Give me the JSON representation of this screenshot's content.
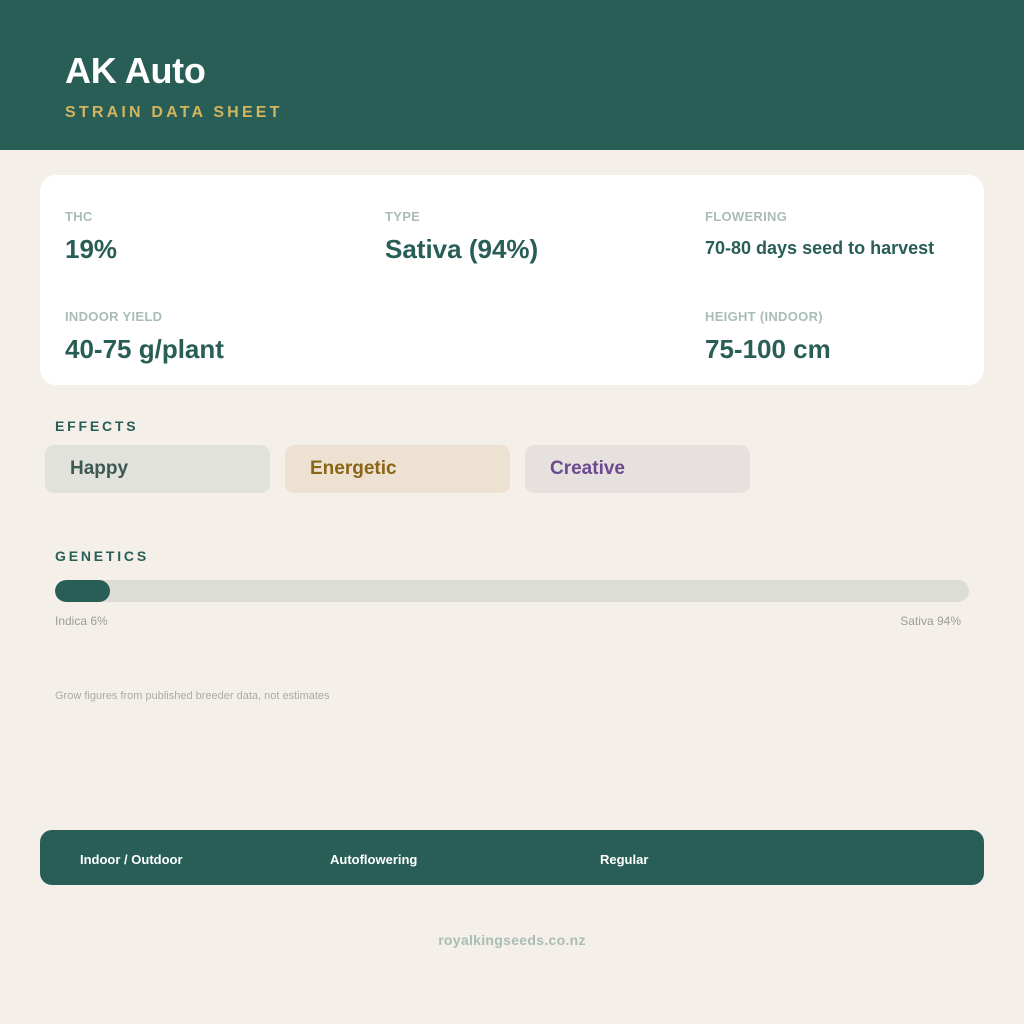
{
  "header": {
    "title": "AK Auto",
    "subtitle": "STRAIN DATA SHEET"
  },
  "stats": {
    "thc": {
      "label": "THC",
      "value": "19%"
    },
    "type": {
      "label": "TYPE",
      "value": "Sativa (94%)"
    },
    "flowering": {
      "label": "FLOWERING",
      "value": "70-80 days seed to harvest"
    },
    "yield": {
      "label": "INDOOR YIELD",
      "value": "40-75 g/plant"
    },
    "height": {
      "label": "HEIGHT (INDOOR)",
      "value": "75-100 cm"
    }
  },
  "effects": {
    "title": "EFFECTS",
    "items": [
      {
        "label": "Happy",
        "text_color": "#3d5a52",
        "bg_color": "#e1e2dc"
      },
      {
        "label": "Energetic",
        "text_color": "#8a6417",
        "bg_color": "#ede2d2"
      },
      {
        "label": "Creative",
        "text_color": "#6b4a90",
        "bg_color": "#e6e0df"
      }
    ]
  },
  "genetics": {
    "title": "GENETICS",
    "indica_label": "Indica 6%",
    "sativa_label": "Sativa 94%",
    "indica_percent": 6
  },
  "note": "Grow figures from published breeder data, not estimates",
  "footer": {
    "items": [
      "Indoor / Outdoor",
      "Autoflowering",
      "Regular"
    ]
  },
  "site": "royalkingseeds.co.nz",
  "colors": {
    "brand": "#285e56",
    "accent": "#d4b55f",
    "background": "#f5efe9"
  }
}
